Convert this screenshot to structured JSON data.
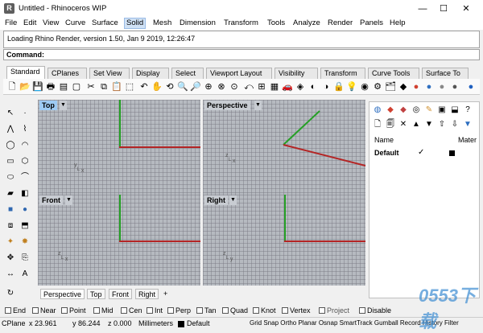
{
  "window": {
    "title": "Untitled - Rhinoceros WIP",
    "app_icon": "R",
    "min": "—",
    "max": "☐",
    "close": "✕"
  },
  "menus": [
    "File",
    "Edit",
    "View",
    "Curve",
    "Surface",
    "Solid",
    "Mesh",
    "Dimension",
    "Transform",
    "Tools",
    "Analyze",
    "Render",
    "Panels",
    "Help"
  ],
  "history": {
    "text": "Loading Rhino Render, version 1.50, Jan  9 2019, 12:26:47"
  },
  "command": {
    "label": "Command:"
  },
  "tabs": [
    "Standard",
    "CPlanes",
    "Set View",
    "Display",
    "Select",
    "Viewport Layout",
    "Visibility",
    "Transform",
    "Curve Tools",
    "Surface To"
  ],
  "viewports": {
    "top": "Top",
    "perspective": "Perspective",
    "front": "Front",
    "right": "Right"
  },
  "viewport_tabs": [
    "Perspective",
    "Top",
    "Front",
    "Right"
  ],
  "layers": {
    "col_name": "Name",
    "col_material": "Mater",
    "row_name": "Default",
    "check": "✓"
  },
  "osnaps": [
    "End",
    "Near",
    "Point",
    "Mid",
    "Cen",
    "Int",
    "Perp",
    "Tan",
    "Quad",
    "Knot",
    "Vertex",
    "Project",
    "Disable"
  ],
  "status": {
    "cplane": "CPlane",
    "x": "x 23.961",
    "y": "y 86.244",
    "z": "z 0.000",
    "units": "Millimeters",
    "layer": "Default",
    "items": "Grid Snap Ortho Planar Osnap SmartTrack Gumball Record History Filter"
  },
  "watermark": "0553下载",
  "colors": {
    "x_axis": "#b42525",
    "y_axis": "#25a025",
    "viewport_bg": "#b6bac0",
    "active_title": "#9ecbf4"
  }
}
